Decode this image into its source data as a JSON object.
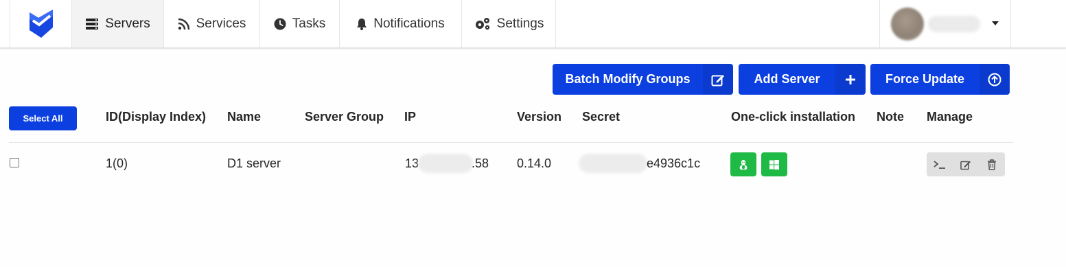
{
  "nav": {
    "items": [
      {
        "label": "Servers",
        "icon": "server-icon",
        "active": true
      },
      {
        "label": "Services",
        "icon": "rss-icon"
      },
      {
        "label": "Tasks",
        "icon": "clock-icon"
      },
      {
        "label": "Notifications",
        "icon": "bell-icon"
      },
      {
        "label": "Settings",
        "icon": "gears-icon"
      }
    ]
  },
  "colors": {
    "primary": "#0b3fe0",
    "success": "#1fba45",
    "muted": "#e0e0e0"
  },
  "actions": {
    "batch_modify": "Batch Modify Groups",
    "add_server": "Add Server",
    "force_update": "Force Update"
  },
  "table": {
    "select_all": "Select All",
    "headers": [
      "ID(Display Index)",
      "Name",
      "Server Group",
      "IP",
      "Version",
      "Secret",
      "One-click installation",
      "Note",
      "Manage"
    ],
    "rows": [
      {
        "id": "1(0)",
        "name": "D1 server",
        "group": "",
        "ip_prefix": "13",
        "ip_suffix": ".58",
        "version": "0.14.0",
        "secret_suffix": "e4936c1c",
        "note": ""
      }
    ]
  }
}
